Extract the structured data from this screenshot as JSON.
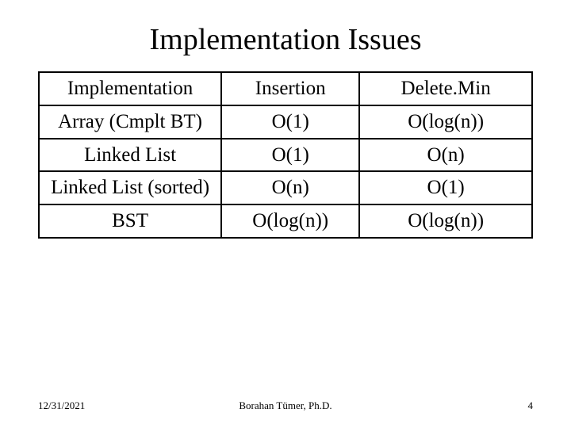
{
  "title": "Implementation Issues",
  "table": {
    "headers": [
      "Implementation",
      "Insertion",
      "Delete.Min"
    ],
    "rows": [
      [
        "Array (Cmplt BT)",
        "O(1)",
        "O(log(n))"
      ],
      [
        "Linked List",
        "O(1)",
        "O(n)"
      ],
      [
        "Linked List (sorted)",
        "O(n)",
        "O(1)"
      ],
      [
        "BST",
        "O(log(n))",
        "O(log(n))"
      ]
    ]
  },
  "footer": {
    "date": "12/31/2021",
    "author": "Borahan Tümer, Ph.D.",
    "page": "4"
  }
}
